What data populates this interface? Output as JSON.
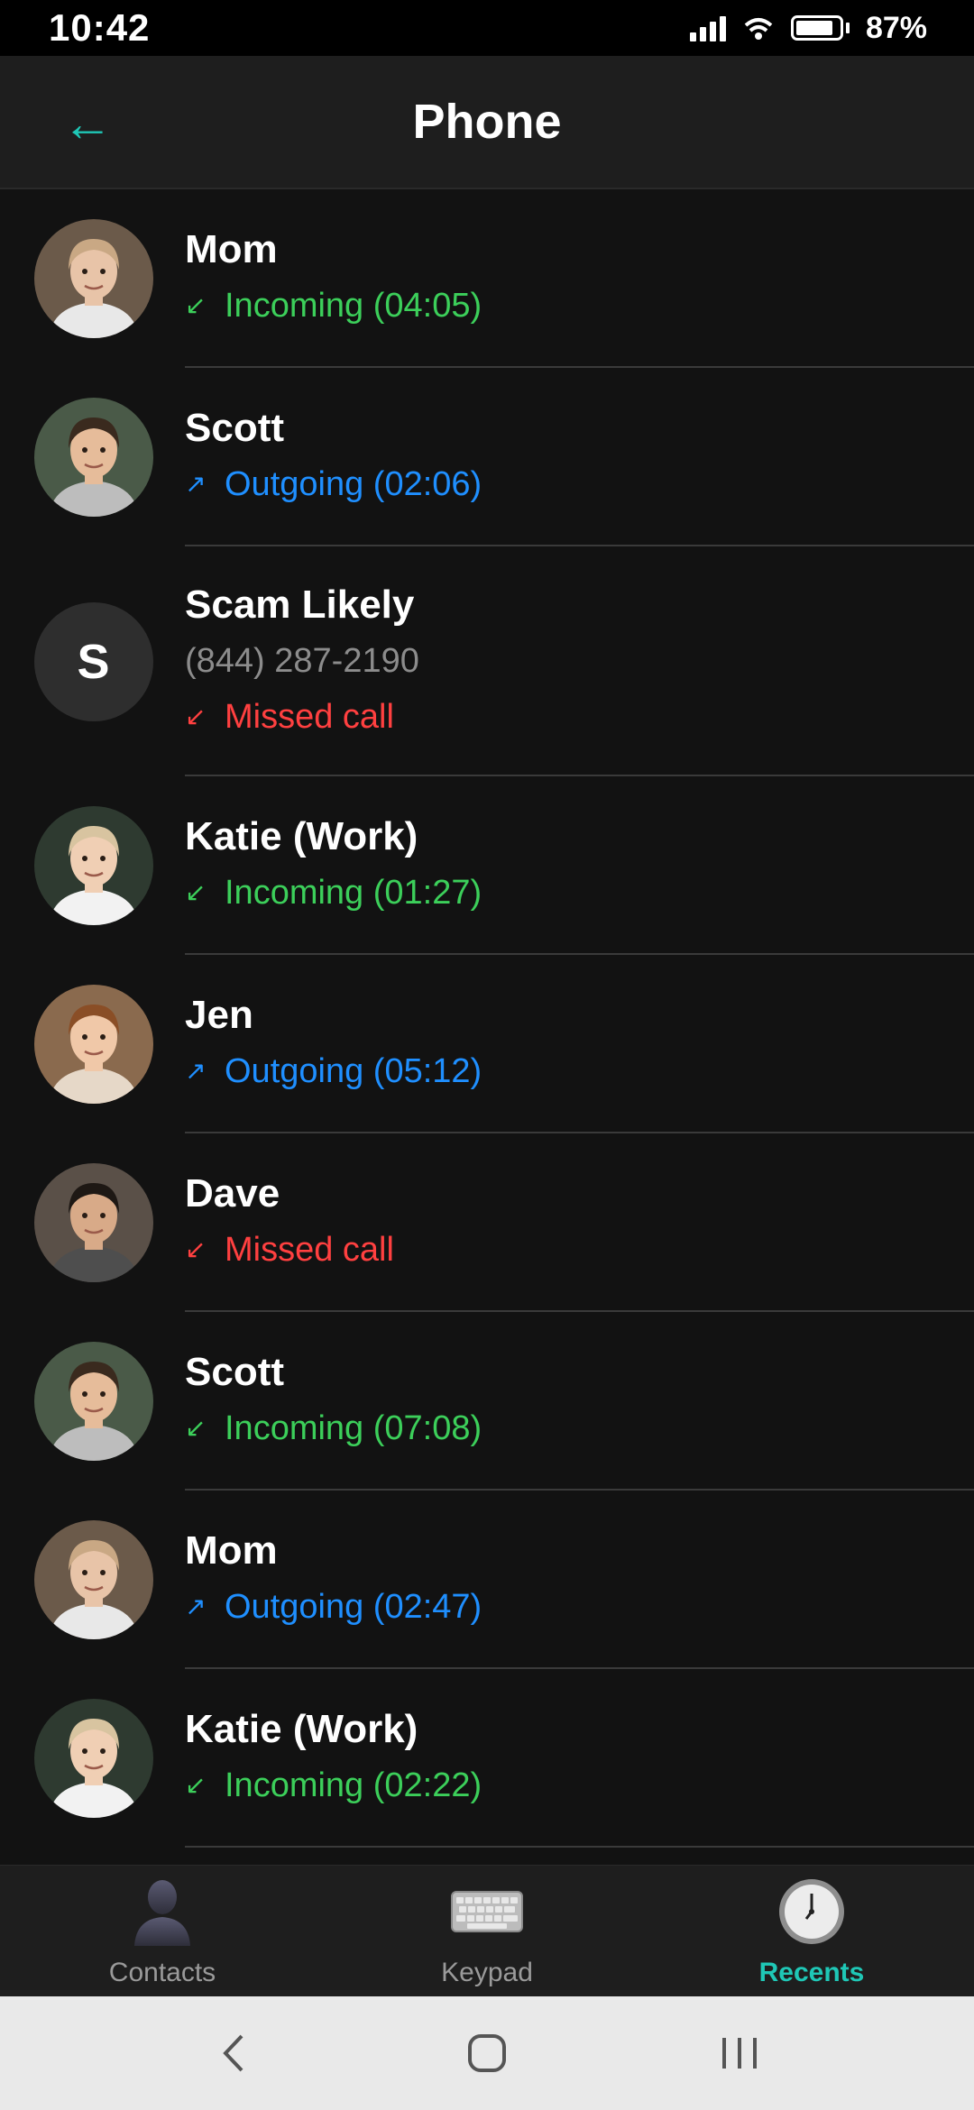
{
  "status_bar": {
    "time": "10:42",
    "battery_percent": "87%",
    "battery_level": 0.87,
    "signal_bars": 4
  },
  "header": {
    "title": "Phone",
    "back_icon": "back-arrow-icon"
  },
  "colors": {
    "accent": "#1fc7b6",
    "incoming": "#3ccf5a",
    "outgoing": "#1f8fff",
    "missed": "#ff4040",
    "background": "#121212"
  },
  "calls": [
    {
      "name": "Mom",
      "number": "",
      "type": "incoming",
      "arrow": "↙",
      "status": "Incoming (04:05)",
      "avatar": "photo-mom"
    },
    {
      "name": "Scott",
      "number": "",
      "type": "outgoing",
      "arrow": "↗",
      "status": "Outgoing (02:06)",
      "avatar": "photo-scott"
    },
    {
      "name": "Scam Likely",
      "number": "(844) 287-2190",
      "type": "missed",
      "arrow": "↙",
      "status": "Missed call",
      "avatar": "letter",
      "avatar_letter": "S"
    },
    {
      "name": "Katie (Work)",
      "number": "",
      "type": "incoming",
      "arrow": "↙",
      "status": "Incoming (01:27)",
      "avatar": "photo-katie"
    },
    {
      "name": "Jen",
      "number": "",
      "type": "outgoing",
      "arrow": "↗",
      "status": "Outgoing (05:12)",
      "avatar": "photo-jen"
    },
    {
      "name": "Dave",
      "number": "",
      "type": "missed",
      "arrow": "↙",
      "status": "Missed call",
      "avatar": "photo-dave"
    },
    {
      "name": "Scott",
      "number": "",
      "type": "incoming",
      "arrow": "↙",
      "status": "Incoming (07:08)",
      "avatar": "photo-scott"
    },
    {
      "name": "Mom",
      "number": "",
      "type": "outgoing",
      "arrow": "↗",
      "status": "Outgoing (02:47)",
      "avatar": "photo-mom"
    },
    {
      "name": "Katie (Work)",
      "number": "",
      "type": "incoming",
      "arrow": "↙",
      "status": "Incoming (02:22)",
      "avatar": "photo-katie"
    }
  ],
  "tabs": [
    {
      "label": "Contacts",
      "icon": "person-icon",
      "active": false
    },
    {
      "label": "Keypad",
      "icon": "keyboard-icon",
      "active": false
    },
    {
      "label": "Recents",
      "icon": "clock-icon",
      "active": true
    }
  ],
  "nav_bar": {
    "back_icon": "nav-back-icon",
    "home_icon": "nav-home-icon",
    "recents_icon": "nav-recents-icon"
  }
}
